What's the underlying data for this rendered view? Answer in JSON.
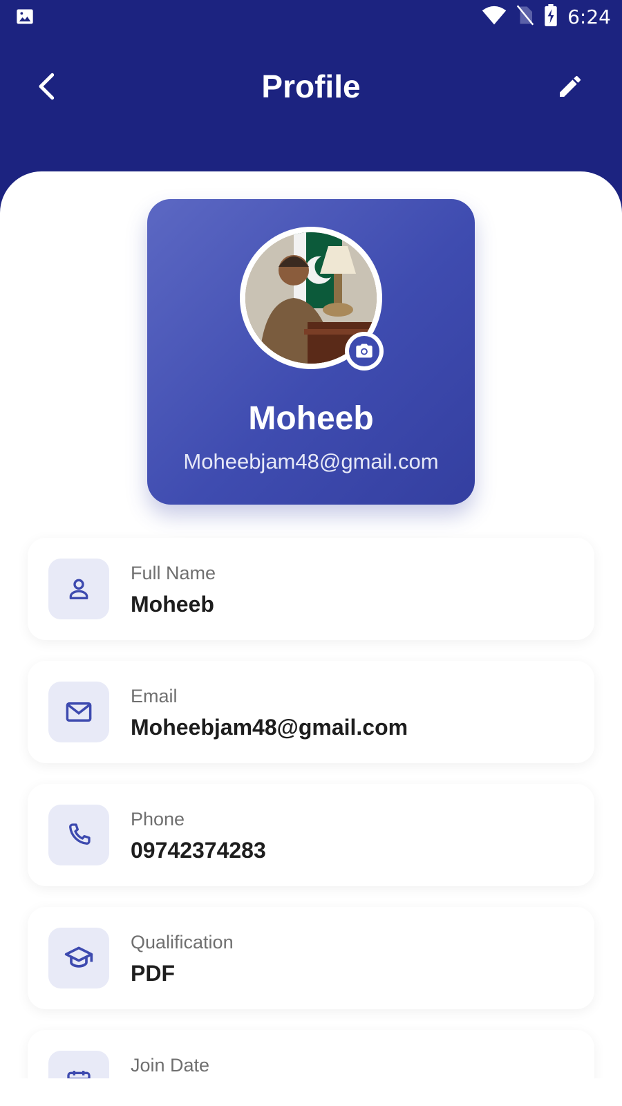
{
  "status_bar": {
    "time": "6:24",
    "icons": [
      "image-notification-icon",
      "wifi-icon",
      "no-sim-icon",
      "battery-charging-icon"
    ]
  },
  "app_bar": {
    "title": "Profile",
    "back_icon": "chevron-left-icon",
    "edit_icon": "pencil-icon"
  },
  "profile_card": {
    "name": "Moheeb",
    "email": "Moheebjam48@gmail.com",
    "camera_icon": "camera-icon"
  },
  "info_items": [
    {
      "icon": "person-icon",
      "label": "Full Name",
      "value": "Moheeb"
    },
    {
      "icon": "mail-icon",
      "label": "Email",
      "value": "Moheebjam48@gmail.com"
    },
    {
      "icon": "phone-icon",
      "label": "Phone",
      "value": "09742374283"
    },
    {
      "icon": "graduation-cap-icon",
      "label": "Qualification",
      "value": "PDF"
    },
    {
      "icon": "calendar-icon",
      "label": "Join Date",
      "value": ""
    }
  ],
  "colors": {
    "app_bar": "#1c2380",
    "card_gradient_start": "#5c68c3",
    "card_gradient_end": "#343fa0",
    "icon_accent": "#3d4aaf",
    "icon_box_bg": "#e8eaf7"
  }
}
